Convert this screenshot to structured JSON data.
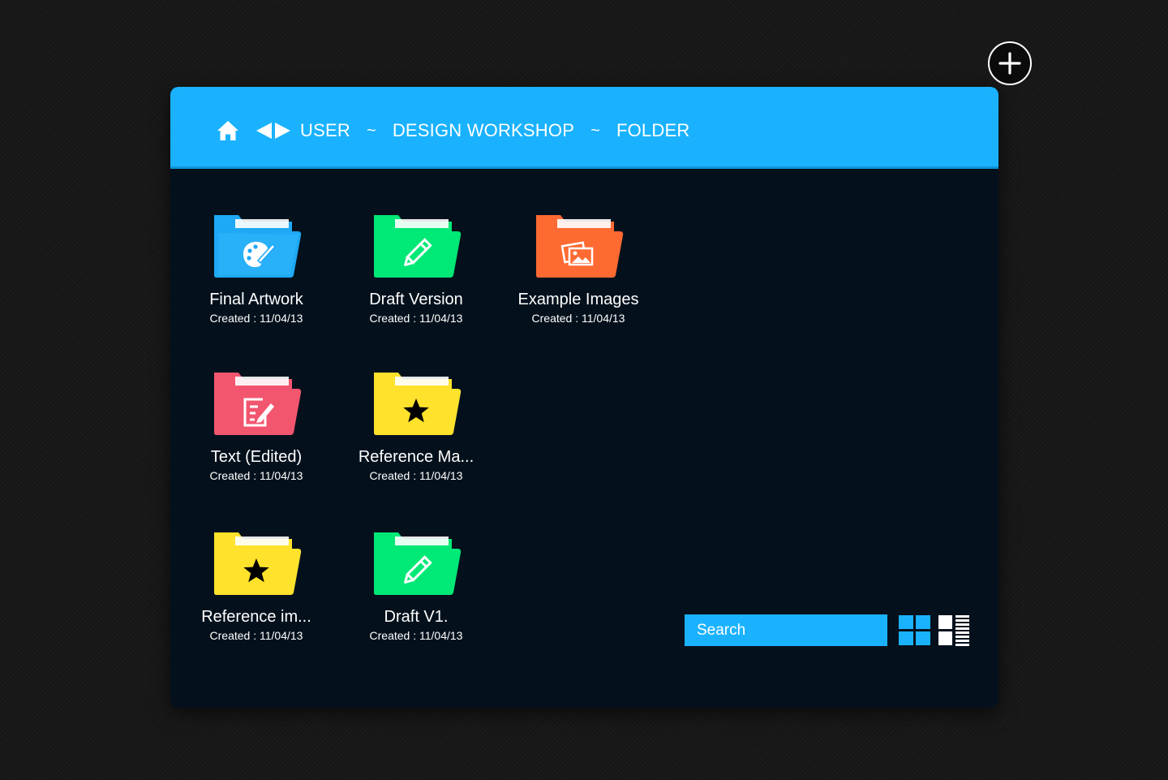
{
  "breadcrumb": {
    "items": [
      "USER",
      "DESIGN WORKSHOP",
      "FOLDER"
    ],
    "separator": "~"
  },
  "folders": [
    {
      "name": "Final Artwork",
      "created": "Created : 11/04/13",
      "color": "#1ea8f5",
      "icon": "palette-icon"
    },
    {
      "name": "Draft Version",
      "created": "Created : 11/04/13",
      "color": "#00e876",
      "icon": "pencil-icon"
    },
    {
      "name": "Example Images",
      "created": "Created : 11/04/13",
      "color": "#ff6a33",
      "icon": "images-icon"
    },
    {
      "name": "Text (Edited)",
      "created": "Created : 11/04/13",
      "color": "#f2566e",
      "icon": "edit-document-icon"
    },
    {
      "name": "Reference Ma...",
      "created": "Created : 11/04/13",
      "color": "#ffe22b",
      "icon": "star-icon"
    },
    {
      "name": "Reference im...",
      "created": "Created : 11/04/13",
      "color": "#ffe22b",
      "icon": "star-icon"
    },
    {
      "name": "Draft V1.",
      "created": "Created : 11/04/13",
      "color": "#00e876",
      "icon": "pencil-icon"
    }
  ],
  "search": {
    "placeholder": "Search"
  },
  "colors": {
    "accent": "#1ab2ff",
    "panel_background": "#04111c",
    "page_background": "#181818"
  }
}
